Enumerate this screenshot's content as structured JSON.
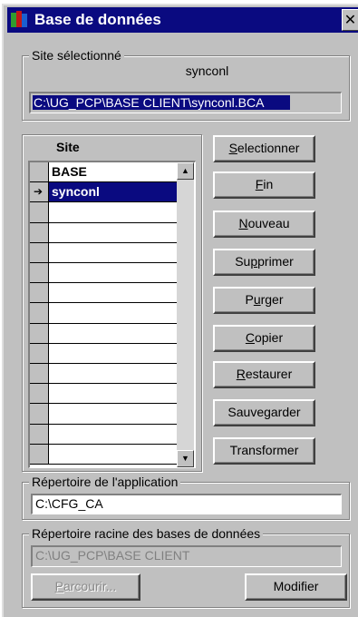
{
  "window": {
    "title": "Base de données",
    "close_glyph": "✕",
    "icon": "database-app-icon"
  },
  "site_selected": {
    "legend": "Site sélectionné",
    "name": "synconl",
    "path": "C:\\UG_PCP\\BASE CLIENT\\synconl.BCA"
  },
  "grid": {
    "header": "Site",
    "rows": [
      {
        "marker": "",
        "label": "BASE",
        "selected": false
      },
      {
        "marker": "➔",
        "label": "synconl",
        "selected": true
      },
      {
        "marker": "",
        "label": "",
        "selected": false
      },
      {
        "marker": "",
        "label": "",
        "selected": false
      },
      {
        "marker": "",
        "label": "",
        "selected": false
      },
      {
        "marker": "",
        "label": "",
        "selected": false
      },
      {
        "marker": "",
        "label": "",
        "selected": false
      },
      {
        "marker": "",
        "label": "",
        "selected": false
      },
      {
        "marker": "",
        "label": "",
        "selected": false
      },
      {
        "marker": "",
        "label": "",
        "selected": false
      },
      {
        "marker": "",
        "label": "",
        "selected": false
      },
      {
        "marker": "",
        "label": "",
        "selected": false
      },
      {
        "marker": "",
        "label": "",
        "selected": false
      },
      {
        "marker": "",
        "label": "",
        "selected": false
      },
      {
        "marker": "",
        "label": "",
        "selected": false
      }
    ],
    "scroll_up": "▲",
    "scroll_down": "▼"
  },
  "buttons": {
    "selectionner": {
      "mn": "S",
      "rest": "electionner"
    },
    "fin": {
      "mn": "F",
      "rest": "in"
    },
    "nouveau": {
      "mn": "N",
      "rest": "ouveau"
    },
    "supprimer": {
      "pre": "Su",
      "mn": "p",
      "rest": "primer"
    },
    "purger": {
      "pre": "P",
      "mn": "u",
      "rest": "rger"
    },
    "copier": {
      "mn": "C",
      "rest": "opier"
    },
    "restaurer": {
      "mn": "R",
      "rest": "estaurer"
    },
    "sauvegarder": "Sauvegarder",
    "transformer": "Transformer"
  },
  "app_dir": {
    "legend": "Répertoire de l'application",
    "value": "C:\\CFG_CA"
  },
  "db_root": {
    "legend": "Répertoire racine des bases de données",
    "value": "C:\\UG_PCP\\BASE CLIENT",
    "browse": {
      "mn": "P",
      "rest": "arcourir..."
    },
    "modify": "Modifier"
  }
}
